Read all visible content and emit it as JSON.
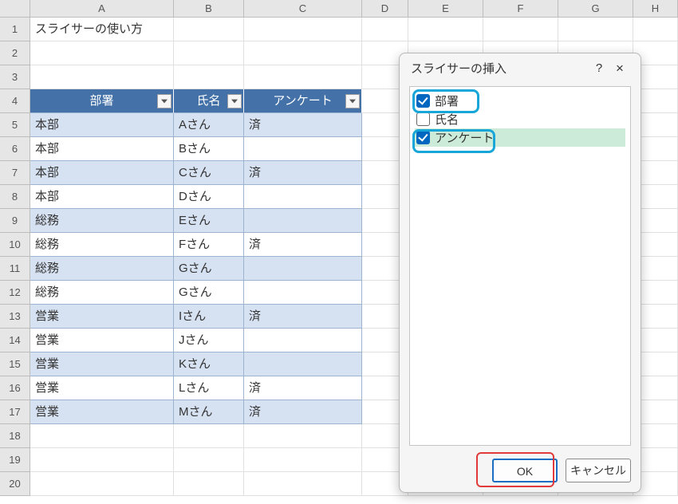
{
  "columns": [
    "A",
    "B",
    "C",
    "D",
    "E",
    "F",
    "G",
    "H"
  ],
  "title_cell": "スライサーの使い方",
  "table": {
    "headers": [
      "部署",
      "氏名",
      "アンケート"
    ],
    "rows": [
      {
        "dept": "本部",
        "name": "Aさん",
        "ans": "済"
      },
      {
        "dept": "本部",
        "name": "Bさん",
        "ans": ""
      },
      {
        "dept": "本部",
        "name": "Cさん",
        "ans": "済"
      },
      {
        "dept": "本部",
        "name": "Dさん",
        "ans": ""
      },
      {
        "dept": "総務",
        "name": "Eさん",
        "ans": ""
      },
      {
        "dept": "総務",
        "name": "Fさん",
        "ans": "済"
      },
      {
        "dept": "総務",
        "name": "Gさん",
        "ans": ""
      },
      {
        "dept": "総務",
        "name": "Gさん",
        "ans": ""
      },
      {
        "dept": "営業",
        "name": "Iさん",
        "ans": "済"
      },
      {
        "dept": "営業",
        "name": "Jさん",
        "ans": ""
      },
      {
        "dept": "営業",
        "name": "Kさん",
        "ans": ""
      },
      {
        "dept": "営業",
        "name": "Lさん",
        "ans": "済"
      },
      {
        "dept": "営業",
        "name": "Mさん",
        "ans": "済"
      }
    ]
  },
  "dialog": {
    "title": "スライサーの挿入",
    "help": "?",
    "close": "×",
    "options": [
      {
        "label": "部署",
        "checked": true,
        "selected": false
      },
      {
        "label": "氏名",
        "checked": false,
        "selected": false
      },
      {
        "label": "アンケート",
        "checked": true,
        "selected": true
      }
    ],
    "ok": "OK",
    "cancel": "キャンセル"
  },
  "row_count": 20
}
